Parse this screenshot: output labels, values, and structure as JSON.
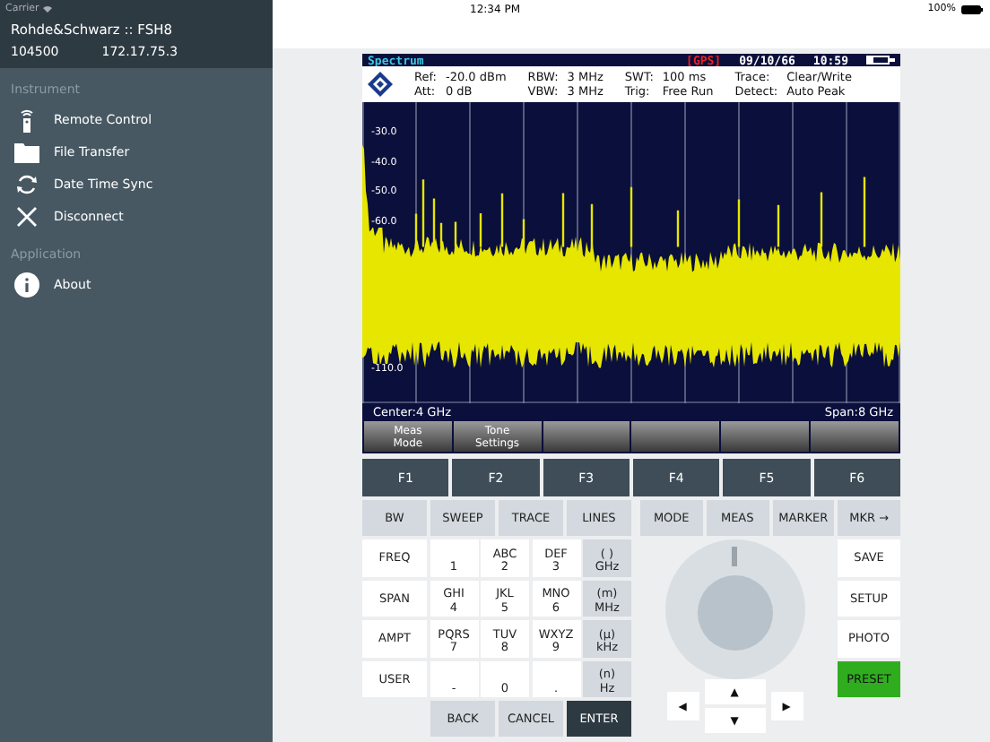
{
  "status_bar": {
    "carrier": "Carrier",
    "time": "12:34 PM",
    "battery": "100%"
  },
  "sidebar": {
    "device": "Rohde&Schwarz :: FSH8",
    "serial": "104500",
    "ip": "172.17.75.3",
    "sections": [
      {
        "title": "Instrument",
        "items": [
          {
            "label": "Remote Control",
            "kind": "remote"
          },
          {
            "label": "File Transfer",
            "kind": "folder"
          },
          {
            "label": "Date Time Sync",
            "kind": "sync"
          },
          {
            "label": "Disconnect",
            "kind": "close"
          }
        ]
      },
      {
        "title": "Application",
        "items": [
          {
            "label": "About",
            "kind": "info"
          }
        ]
      }
    ]
  },
  "spectrum": {
    "title": "Spectrum",
    "gps": "[GPS]",
    "date": "09/10/66",
    "time": "10:59",
    "settings": [
      [
        {
          "label": "Ref:",
          "value": "-20.0 dBm"
        },
        {
          "label": "Att:",
          "value": "0 dB"
        }
      ],
      [
        {
          "label": "RBW:",
          "value": "3 MHz"
        },
        {
          "label": "VBW:",
          "value": "3 MHz"
        }
      ],
      [
        {
          "label": "SWT:",
          "value": "100 ms"
        },
        {
          "label": "Trig:",
          "value": "Free Run"
        }
      ],
      [
        {
          "label": "Trace:",
          "value": "Clear/Write"
        },
        {
          "label": "Detect:",
          "value": "Auto Peak"
        }
      ]
    ],
    "y_labels": [
      "-30.0",
      "-40.0",
      "-50.0",
      "-60.0",
      "-110.0"
    ],
    "center": "Center:4 GHz",
    "span": "Span:8 GHz",
    "softkeys": [
      "Meas\nMode",
      "Tone\nSettings"
    ]
  },
  "function_keys": [
    "F1",
    "F2",
    "F3",
    "F4",
    "F5",
    "F6"
  ],
  "top_keys": [
    "BW",
    "SWEEP",
    "TRACE",
    "LINES",
    "MODE",
    "MEAS",
    "MARKER",
    "MKR →"
  ],
  "keypad": [
    [
      {
        "kind": "command",
        "label": "FREQ"
      },
      {
        "kind": "digit",
        "digit": "1"
      },
      {
        "kind": "digit",
        "letters": "ABC",
        "digit": "2"
      },
      {
        "kind": "digit",
        "letters": "DEF",
        "digit": "3"
      },
      {
        "kind": "unit",
        "prefix": "( )",
        "unit": "GHz"
      }
    ],
    [
      {
        "kind": "command",
        "label": "SPAN"
      },
      {
        "kind": "digit",
        "letters": "GHI",
        "digit": "4"
      },
      {
        "kind": "digit",
        "letters": "JKL",
        "digit": "5"
      },
      {
        "kind": "digit",
        "letters": "MNO",
        "digit": "6"
      },
      {
        "kind": "unit",
        "prefix": "(m)",
        "unit": "MHz"
      }
    ],
    [
      {
        "kind": "command",
        "label": "AMPT"
      },
      {
        "kind": "digit",
        "letters": "PQRS",
        "digit": "7"
      },
      {
        "kind": "digit",
        "letters": "TUV",
        "digit": "8"
      },
      {
        "kind": "digit",
        "letters": "WXYZ",
        "digit": "9"
      },
      {
        "kind": "unit",
        "prefix": "(µ)",
        "unit": "kHz"
      }
    ],
    [
      {
        "kind": "command",
        "label": "USER"
      },
      {
        "kind": "digit",
        "digit": "-"
      },
      {
        "kind": "digit",
        "digit": "0"
      },
      {
        "kind": "digit",
        "digit": "."
      },
      {
        "kind": "unit",
        "prefix": "(n)",
        "unit": "Hz"
      }
    ]
  ],
  "bottom_keys": [
    {
      "label": "BACK",
      "kind": "plain"
    },
    {
      "label": "CANCEL",
      "kind": "plain"
    },
    {
      "label": "ENTER",
      "kind": "primary"
    }
  ],
  "side_keys": [
    {
      "label": "SAVE",
      "kind": "plain"
    },
    {
      "label": "SETUP",
      "kind": "plain"
    },
    {
      "label": "PHOTO",
      "kind": "plain"
    },
    {
      "label": "PRESET",
      "kind": "preset"
    }
  ],
  "arrows": {
    "left": "◀",
    "up": "▲",
    "down": "▼",
    "right": "▶"
  }
}
